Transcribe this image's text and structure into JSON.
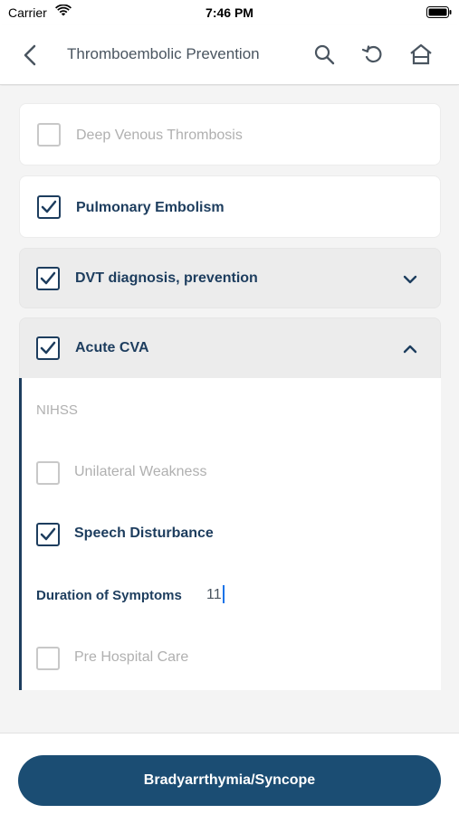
{
  "status_bar": {
    "carrier": "Carrier",
    "time": "7:46 PM"
  },
  "nav": {
    "title": "Thromboembolic Prevention",
    "icons": [
      "back-icon",
      "search-icon",
      "refresh-icon",
      "home-icon"
    ]
  },
  "items": {
    "dvt": {
      "label": "Deep Venous Thrombosis",
      "checked": false
    },
    "pe": {
      "label": "Pulmonary Embolism",
      "checked": true
    },
    "dvt_dx": {
      "label": "DVT diagnosis, prevention",
      "checked": true,
      "expanded": false
    },
    "cva": {
      "label": "Acute CVA",
      "checked": true,
      "expanded": true
    }
  },
  "cva_section": {
    "heading": "NIHSS",
    "unilateral": {
      "label": "Unilateral Weakness",
      "checked": false
    },
    "speech": {
      "label": "Speech Disturbance",
      "checked": true
    },
    "duration": {
      "label": "Duration of Symptoms",
      "value": "11"
    },
    "prehospital": {
      "label": "Pre Hospital Care",
      "checked": false
    }
  },
  "footer": {
    "button_label": "Bradyarrthymia/Syncope"
  },
  "colors": {
    "accent": "#1d3d5e",
    "button": "#1b4d73",
    "muted": "#b0b0b0",
    "cursor": "#1a73e8"
  }
}
